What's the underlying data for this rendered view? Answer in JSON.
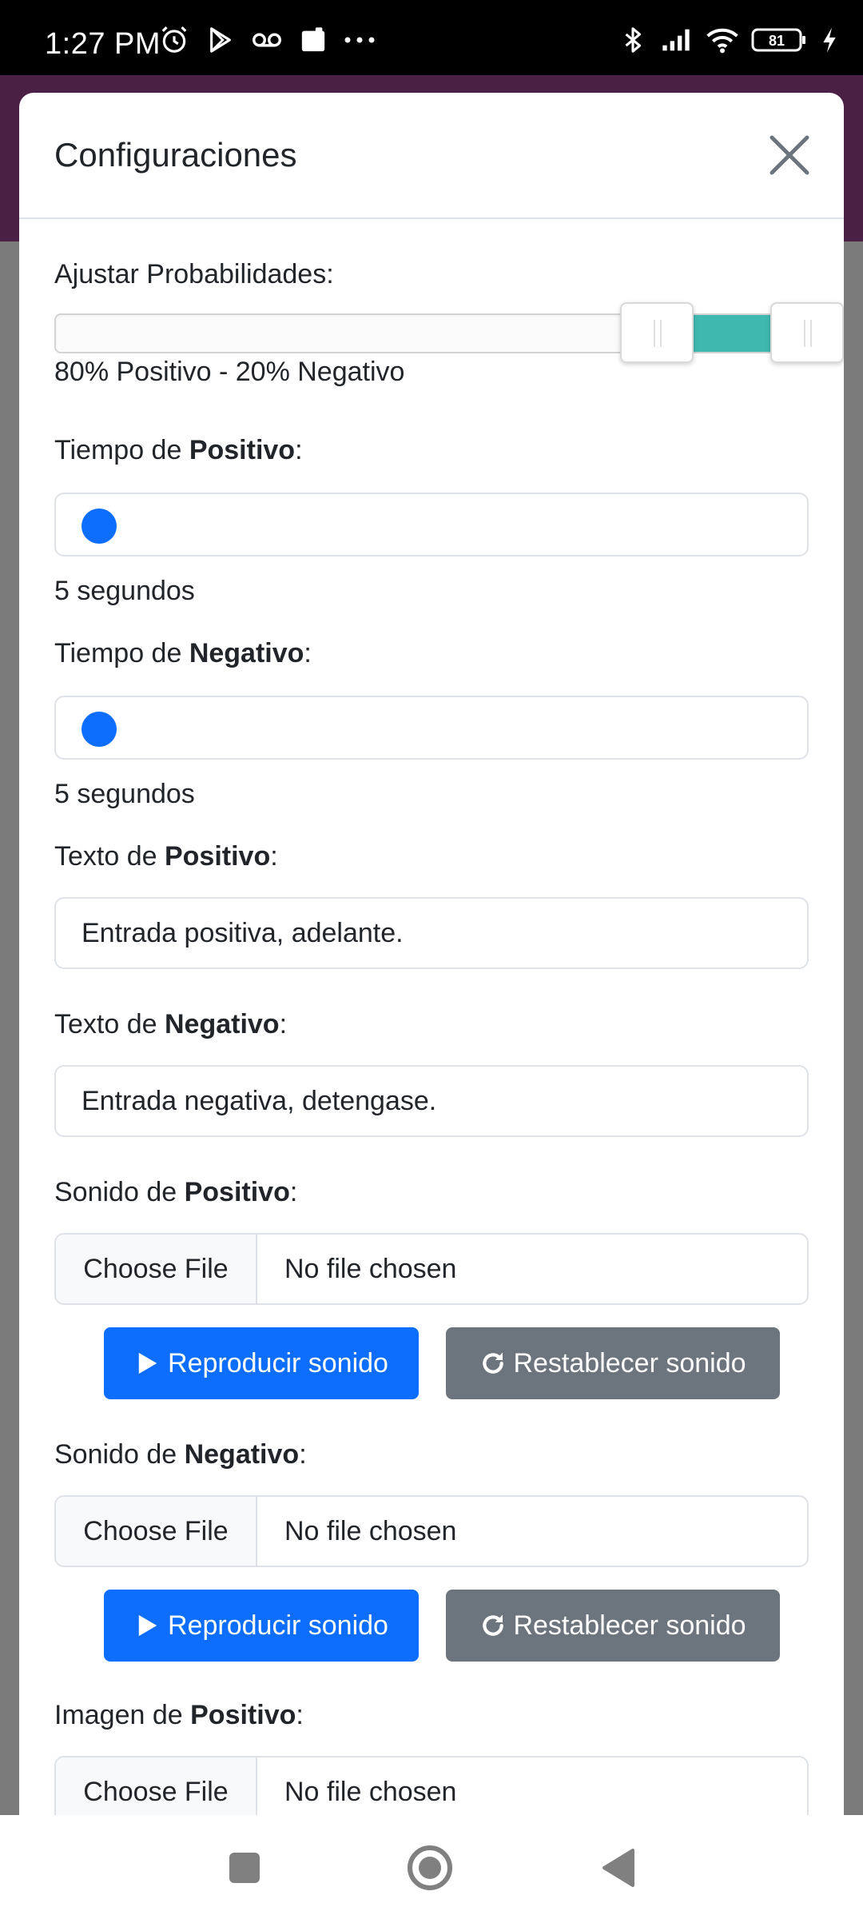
{
  "status_bar": {
    "time": "1:27 PM",
    "battery": "81",
    "left_icons": [
      "alarm-icon",
      "play-store-icon",
      "voicemail-icon",
      "app-notification-icon",
      "more-notifications-icon"
    ],
    "right_icons": [
      "bluetooth-icon",
      "signal-icon",
      "wifi-icon",
      "battery-icon",
      "charging-icon"
    ]
  },
  "modal": {
    "title": "Configuraciones",
    "close_icon": "close-icon"
  },
  "probability": {
    "label": "Ajustar Probabilidades:",
    "text": "80% Positivo - 20% Negativo",
    "connect_start_fraction": 0.8,
    "connect_end_fraction": 1.0,
    "accent_color": "#3fb8af"
  },
  "positive_time": {
    "label_prefix": "Tiempo de ",
    "label_bold": "Positivo",
    "label_suffix": ":",
    "value_text": "5 segundos",
    "thumb_color": "#0d6efd"
  },
  "negative_time": {
    "label_prefix": "Tiempo de ",
    "label_bold": "Negativo",
    "label_suffix": ":",
    "value_text": "5 segundos"
  },
  "positive_text": {
    "label_prefix": "Texto de ",
    "label_bold": "Positivo",
    "label_suffix": ":",
    "value": "Entrada positiva, adelante."
  },
  "negative_text": {
    "label_prefix": "Texto de ",
    "label_bold": "Negativo",
    "label_suffix": ":",
    "value": "Entrada negativa, detengase."
  },
  "positive_sound": {
    "label_prefix": "Sonido de ",
    "label_bold": "Positivo",
    "label_suffix": ":",
    "choose_label": "Choose File",
    "file_status": "No file chosen",
    "play_label": "Reproducir sonido",
    "reset_label": "Restablecer sonido"
  },
  "negative_sound": {
    "label_prefix": "Sonido de ",
    "label_bold": "Negativo",
    "label_suffix": ":",
    "choose_label": "Choose File",
    "file_status": "No file chosen",
    "play_label": "Reproducir sonido",
    "reset_label": "Restablecer sonido"
  },
  "positive_image": {
    "label_prefix": "Imagen de ",
    "label_bold": "Positivo",
    "label_suffix": ":",
    "choose_label": "Choose File",
    "file_status": "No file chosen"
  },
  "colors": {
    "primary": "#0d6efd",
    "secondary": "#6c757d",
    "backdrop_header": "#4a2045"
  },
  "navbar": {
    "icons": [
      "recents-square-icon",
      "home-circle-icon",
      "back-triangle-icon"
    ]
  }
}
